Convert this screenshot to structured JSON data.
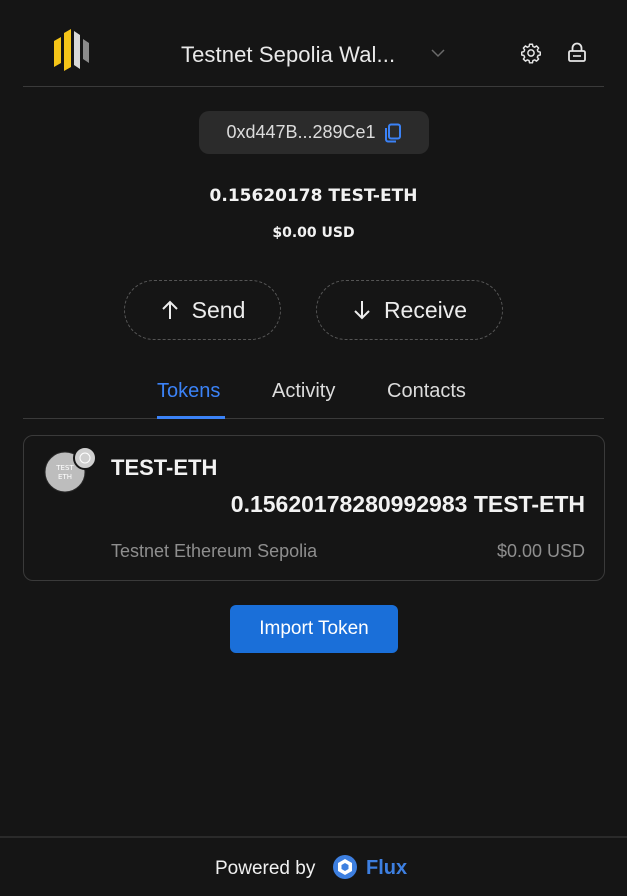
{
  "header": {
    "wallet_name": "Testnet Sepolia Wal...",
    "logo_icon": "brand-logo-icon",
    "chevron_icon": "chevron-down-icon",
    "settings_icon": "gear-icon",
    "lock_icon": "lock-icon"
  },
  "account": {
    "address": "0xd447B...289Ce1",
    "copy_icon": "copy-icon",
    "balance": "0.15620178 TEST-ETH",
    "balance_usd": "$0.00 USD"
  },
  "actions": {
    "send_label": "Send",
    "receive_label": "Receive"
  },
  "tabs": [
    {
      "label": "Tokens",
      "active": true
    },
    {
      "label": "Activity",
      "active": false
    },
    {
      "label": "Contacts",
      "active": false
    }
  ],
  "tokens": [
    {
      "symbol": "TEST-ETH",
      "amount": "0.15620178280992983 TEST-ETH",
      "network": "Testnet Ethereum Sepolia",
      "usd": "$0.00 USD",
      "icon_text_1": "TEST",
      "icon_text_2": "ETH"
    }
  ],
  "import_label": "Import Token",
  "footer": {
    "powered_by": "Powered by",
    "brand": "Flux"
  },
  "colors": {
    "background": "#151515",
    "accent": "#3b82f6",
    "button": "#1a6fd9",
    "muted": "#8e8e8e"
  }
}
